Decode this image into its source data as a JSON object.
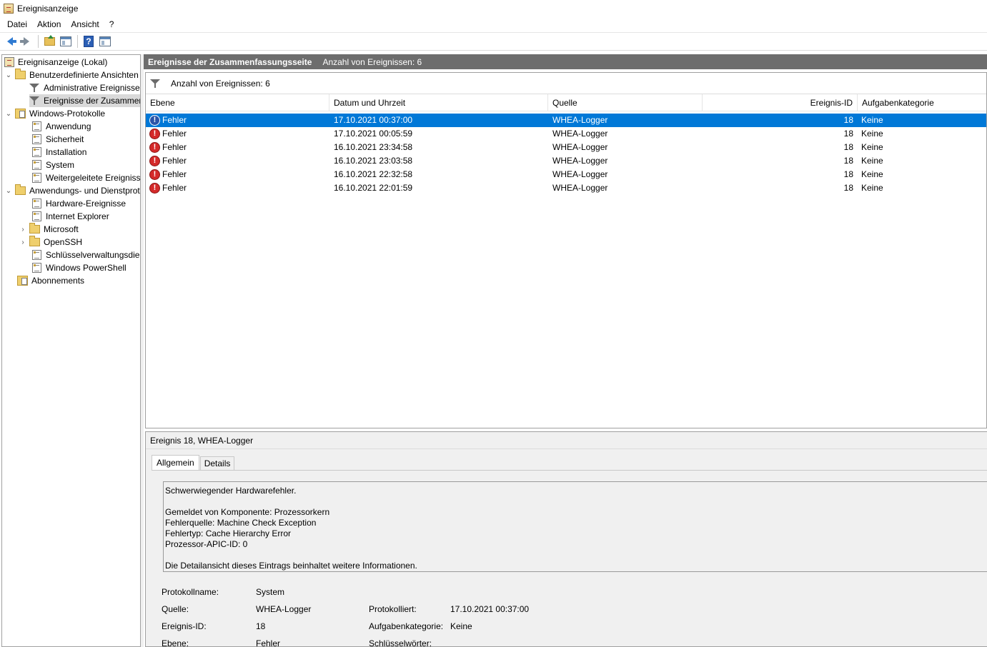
{
  "window": {
    "title": "Ereignisanzeige"
  },
  "menu": [
    "Datei",
    "Aktion",
    "Ansicht",
    "?"
  ],
  "tree": {
    "root": "Ereignisanzeige (Lokal)",
    "custom_views": "Benutzerdefinierte Ansichten",
    "admin_events": "Administrative Ereignisse",
    "summary_events": "Ereignisse der Zusammenfassungsseite",
    "windows_logs": "Windows-Protokolle",
    "application": "Anwendung",
    "security": "Sicherheit",
    "setup": "Installation",
    "system": "System",
    "forwarded": "Weitergeleitete Ereignisse",
    "app_service_logs": "Anwendungs- und Dienstprotokolle",
    "hardware": "Hardware-Ereignisse",
    "ie": "Internet Explorer",
    "microsoft": "Microsoft",
    "openssh": "OpenSSH",
    "key_mgmt": "Schlüsselverwaltungsdienst",
    "powershell": "Windows PowerShell",
    "subscriptions": "Abonnements"
  },
  "header": {
    "title": "Ereignisse der Zusammenfassungsseite",
    "count": "Anzahl von Ereignissen: 6"
  },
  "filter": {
    "text": "Anzahl von Ereignissen: 6"
  },
  "columns": {
    "level": "Ebene",
    "datetime": "Datum und Uhrzeit",
    "source": "Quelle",
    "event_id": "Ereignis-ID",
    "task_category": "Aufgabenkategorie"
  },
  "events": [
    {
      "level": "Fehler",
      "datetime": "17.10.2021 00:37:00",
      "source": "WHEA-Logger",
      "event_id": "18",
      "task_category": "Keine"
    },
    {
      "level": "Fehler",
      "datetime": "17.10.2021 00:05:59",
      "source": "WHEA-Logger",
      "event_id": "18",
      "task_category": "Keine"
    },
    {
      "level": "Fehler",
      "datetime": "16.10.2021 23:34:58",
      "source": "WHEA-Logger",
      "event_id": "18",
      "task_category": "Keine"
    },
    {
      "level": "Fehler",
      "datetime": "16.10.2021 23:03:58",
      "source": "WHEA-Logger",
      "event_id": "18",
      "task_category": "Keine"
    },
    {
      "level": "Fehler",
      "datetime": "16.10.2021 22:32:58",
      "source": "WHEA-Logger",
      "event_id": "18",
      "task_category": "Keine"
    },
    {
      "level": "Fehler",
      "datetime": "16.10.2021 22:01:59",
      "source": "WHEA-Logger",
      "event_id": "18",
      "task_category": "Keine"
    }
  ],
  "detail": {
    "title": "Ereignis 18, WHEA-Logger",
    "tabs": [
      "Allgemein",
      "Details"
    ],
    "description": "Schwerwiegender Hardwarefehler.\n\nGemeldet von Komponente: Prozessorkern\nFehlerquelle: Machine Check Exception\nFehlertyp: Cache Hierarchy Error\nProzessor-APIC-ID: 0\n\nDie Detailansicht dieses Eintrags beinhaltet weitere Informationen.",
    "labels": {
      "log_name": "Protokollname:",
      "source": "Quelle:",
      "logged": "Protokolliert:",
      "event_id": "Ereignis-ID:",
      "task_category": "Aufgabenkategorie:",
      "level": "Ebene:",
      "keywords": "Schlüsselwörter:"
    },
    "values": {
      "log_name": "System",
      "source": "WHEA-Logger",
      "logged": "17.10.2021 00:37:00",
      "event_id": "18",
      "task_category": "Keine",
      "level": "Fehler",
      "keywords": ""
    }
  },
  "colors": {
    "selection": "#0078d7",
    "header_bg": "#6d6d6d",
    "error": "#d42a2a"
  }
}
